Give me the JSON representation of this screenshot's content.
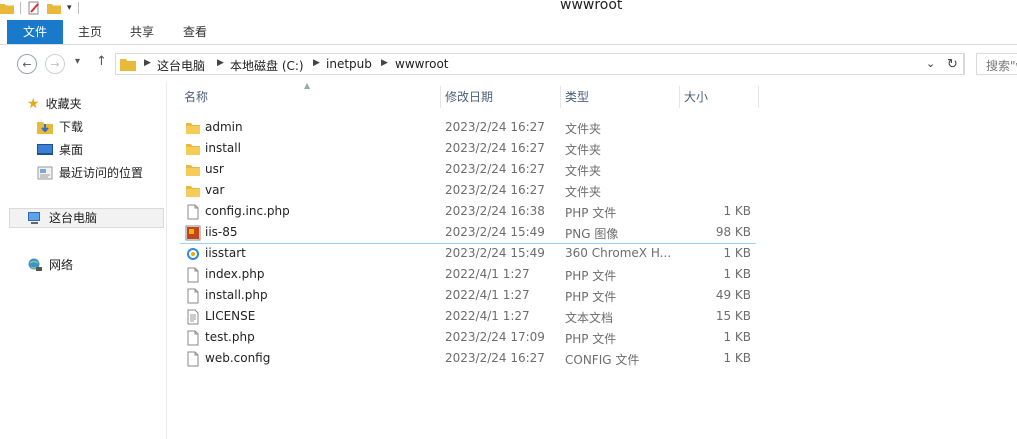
{
  "window": {
    "title": "wwwroot"
  },
  "ribbon": {
    "tabs": [
      "文件",
      "主页",
      "共享",
      "查看"
    ]
  },
  "address": {
    "crumbs": [
      "这台电脑",
      "本地磁盘 (C:)",
      "inetpub",
      "wwwroot"
    ],
    "search_placeholder": "搜索\"wwwroot\""
  },
  "sidebar": {
    "favorites": {
      "label": "收藏夹",
      "items": [
        "下载",
        "桌面",
        "最近访问的位置"
      ]
    },
    "this_pc": "这台电脑",
    "network": "网络"
  },
  "columns": {
    "name": "名称",
    "date": "修改日期",
    "type": "类型",
    "size": "大小"
  },
  "files": [
    {
      "name": "admin",
      "date": "2023/2/24 16:27",
      "type": "文件夹",
      "size": "",
      "icon": "folder-icon"
    },
    {
      "name": "install",
      "date": "2023/2/24 16:27",
      "type": "文件夹",
      "size": "",
      "icon": "folder-icon"
    },
    {
      "name": "usr",
      "date": "2023/2/24 16:27",
      "type": "文件夹",
      "size": "",
      "icon": "folder-icon"
    },
    {
      "name": "var",
      "date": "2023/2/24 16:27",
      "type": "文件夹",
      "size": "",
      "icon": "folder-icon"
    },
    {
      "name": "config.inc.php",
      "date": "2023/2/24 16:38",
      "type": "PHP 文件",
      "size": "1 KB",
      "icon": "file-icon"
    },
    {
      "name": "iis-85",
      "date": "2023/2/24 15:49",
      "type": "PNG 图像",
      "size": "98 KB",
      "icon": "image-icon"
    },
    {
      "name": "iisstart",
      "date": "2023/2/24 15:49",
      "type": "360 ChromeX H...",
      "size": "1 KB",
      "icon": "browser-icon"
    },
    {
      "name": "index.php",
      "date": "2022/4/1 1:27",
      "type": "PHP 文件",
      "size": "1 KB",
      "icon": "file-icon"
    },
    {
      "name": "install.php",
      "date": "2022/4/1 1:27",
      "type": "PHP 文件",
      "size": "49 KB",
      "icon": "file-icon"
    },
    {
      "name": "LICENSE",
      "date": "2022/4/1 1:27",
      "type": "文本文档",
      "size": "15 KB",
      "icon": "text-file-icon"
    },
    {
      "name": "test.php",
      "date": "2023/2/24 17:09",
      "type": "PHP 文件",
      "size": "1 KB",
      "icon": "file-icon"
    },
    {
      "name": "web.config",
      "date": "2023/2/24 16:27",
      "type": "CONFIG 文件",
      "size": "1 KB",
      "icon": "file-icon"
    }
  ],
  "colors": {
    "accent": "#1979ca",
    "folder": "#e8b93b",
    "hover_line": "#99d1ff"
  }
}
